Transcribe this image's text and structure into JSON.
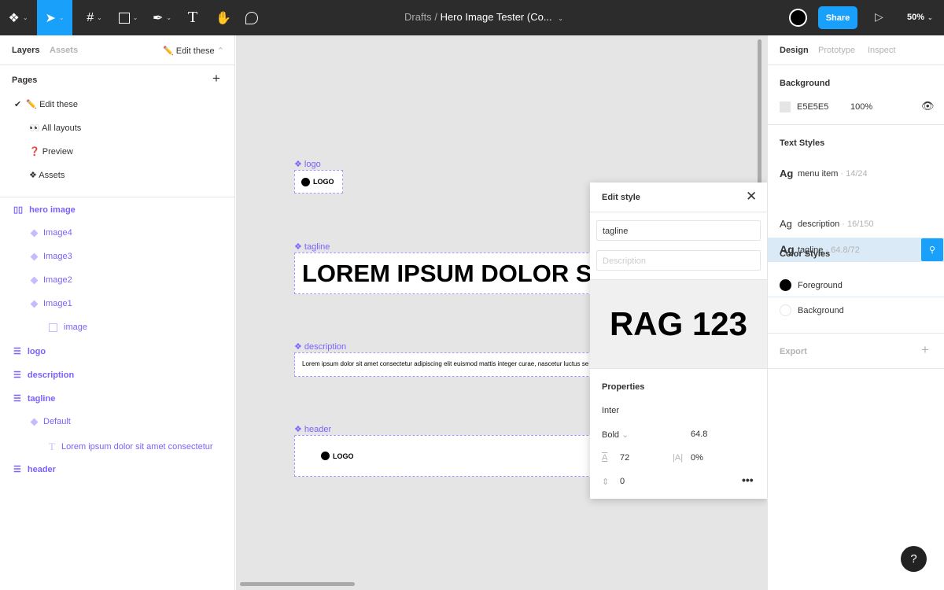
{
  "toolbar": {
    "tools": [
      "figma-menu",
      "move",
      "frame",
      "rectangle",
      "pen",
      "text",
      "hand",
      "comment"
    ],
    "breadcrumb": "Drafts",
    "separator": "/",
    "file_title": "Hero Image Tester (Co...",
    "share": "Share",
    "zoom": "50%",
    "accent": "#18a0fb"
  },
  "left": {
    "tabs": [
      "Layers",
      "Assets"
    ],
    "page_selector": "✏️ Edit these",
    "pages_title": "Pages",
    "pages": [
      {
        "label": "✏️ Edit these",
        "checked": true
      },
      {
        "label": "👀 All layouts"
      },
      {
        "label": "❓ Preview"
      },
      {
        "label": "❖ Assets"
      }
    ],
    "layers": [
      {
        "label": "hero image",
        "icon": "columns-icon"
      },
      {
        "label": "Image4",
        "icon": "component-icon"
      },
      {
        "label": "Image3",
        "icon": "component-icon"
      },
      {
        "label": "Image2",
        "icon": "component-icon"
      },
      {
        "label": "Image1",
        "icon": "component-icon"
      },
      {
        "label": "image",
        "icon": "image-icon"
      },
      {
        "label": "logo",
        "icon": "rows-icon"
      },
      {
        "label": "description",
        "icon": "rows-icon"
      },
      {
        "label": "tagline",
        "icon": "rows-icon"
      },
      {
        "label": "Default",
        "icon": "component-icon"
      },
      {
        "label": "Lorem ipsum dolor sit amet consectetur",
        "icon": "text-icon"
      },
      {
        "label": "header",
        "icon": "rows-icon"
      }
    ]
  },
  "canvas": {
    "logo_label": "logo",
    "logo_text": "LOGO",
    "tagline_label": "tagline",
    "tagline_text": "LOREM IPSUM DOLOR SIT",
    "description_label": "description",
    "description_text": "Lorem ipsum dolor sit amet consectetur adipiscing elit euismod mattis integer curae, nascetur luctus se",
    "header_label": "header",
    "header_logo": "LOGO"
  },
  "popup": {
    "title": "Edit style",
    "name_value": "tagline",
    "description_placeholder": "Description",
    "preview": "RAG 123",
    "properties_title": "Properties",
    "font": "Inter",
    "weight": "Bold",
    "size": "64.8",
    "line_height": "72",
    "letter_spacing": "0%",
    "paragraph_spacing": "0"
  },
  "right": {
    "tabs": [
      "Design",
      "Prototype",
      "Inspect"
    ],
    "background_title": "Background",
    "bg_hex": "E5E5E5",
    "bg_opacity": "100%",
    "text_styles_title": "Text Styles",
    "text_styles": [
      {
        "sample": "Ag",
        "name": "menu item",
        "meta": "· 14/24"
      },
      {
        "sample": "Ag",
        "name": "tagline",
        "meta": "· 64.8/72",
        "selected": true
      },
      {
        "sample": "Ag",
        "name": "description",
        "meta": "· 16/150"
      }
    ],
    "color_styles_title": "Color Styles",
    "color_styles": [
      {
        "name": "Foreground",
        "color": "#000000"
      },
      {
        "name": "Background",
        "color": "#ffffff"
      }
    ],
    "export_title": "Export",
    "help": "?"
  }
}
